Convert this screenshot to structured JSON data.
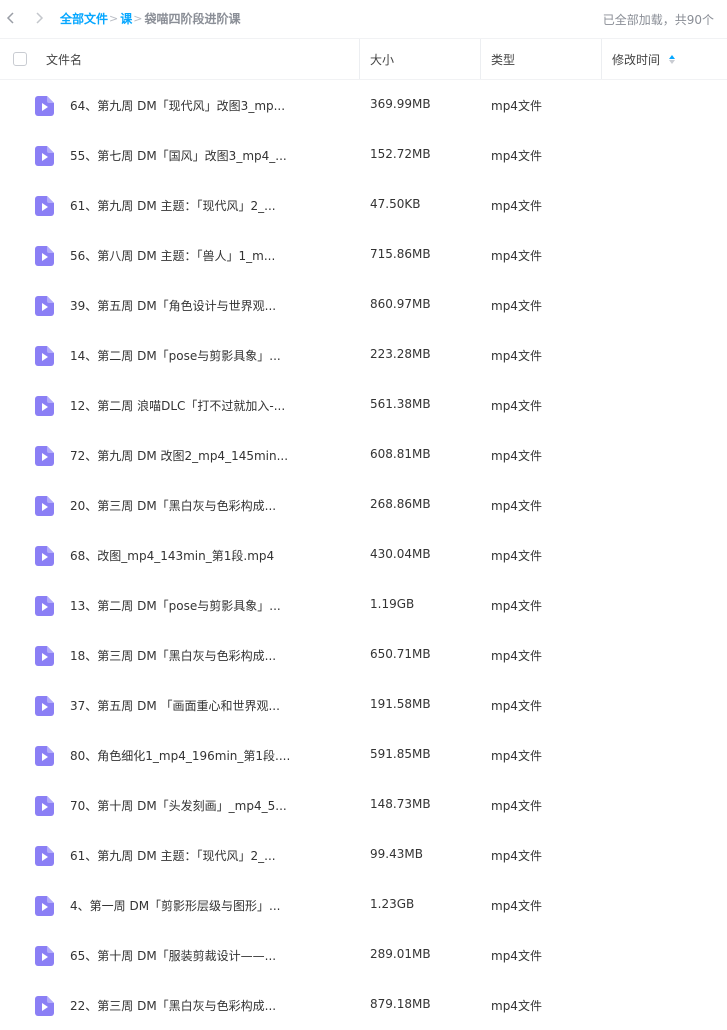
{
  "nav": {
    "breadcrumb": [
      "全部文件",
      "课",
      "袋喵四阶段进阶课"
    ],
    "load_status": "已全部加载，共90个"
  },
  "table": {
    "columns": [
      "文件名",
      "大小",
      "类型",
      "修改时间"
    ],
    "sort_column": "修改时间",
    "rows": [
      {
        "name": "64、第九周 DM「现代风」改图3_mp...",
        "size": "369.99MB",
        "type": "mp4文件"
      },
      {
        "name": "55、第七周 DM「国风」改图3_mp4_...",
        "size": "152.72MB",
        "type": "mp4文件"
      },
      {
        "name": "61、第九周 DM 主题：「现代风」2_...",
        "size": "47.50KB",
        "type": "mp4文件"
      },
      {
        "name": "56、第八周 DM 主题：「兽人」1_m...",
        "size": "715.86MB",
        "type": "mp4文件"
      },
      {
        "name": "39、第五周 DM「角色设计与世界观...",
        "size": "860.97MB",
        "type": "mp4文件"
      },
      {
        "name": "14、第二周 DM「pose与剪影具象」...",
        "size": "223.28MB",
        "type": "mp4文件"
      },
      {
        "name": "12、第二周 浪喵DLC「打不过就加入-...",
        "size": "561.38MB",
        "type": "mp4文件"
      },
      {
        "name": "72、第九周 DM 改图2_mp4_145min...",
        "size": "608.81MB",
        "type": "mp4文件"
      },
      {
        "name": "20、第三周 DM「黑白灰与色彩构成...",
        "size": "268.86MB",
        "type": "mp4文件"
      },
      {
        "name": "68、改图_mp4_143min_第1段.mp4",
        "size": "430.04MB",
        "type": "mp4文件"
      },
      {
        "name": "13、第二周 DM「pose与剪影具象」...",
        "size": "1.19GB",
        "type": "mp4文件"
      },
      {
        "name": "18、第三周 DM「黑白灰与色彩构成...",
        "size": "650.71MB",
        "type": "mp4文件"
      },
      {
        "name": "37、第五周 DM 「画面重心和世界观...",
        "size": "191.58MB",
        "type": "mp4文件"
      },
      {
        "name": "80、角色细化1_mp4_196min_第1段....",
        "size": "591.85MB",
        "type": "mp4文件"
      },
      {
        "name": "70、第十周 DM「头发刻画」_mp4_5...",
        "size": "148.73MB",
        "type": "mp4文件"
      },
      {
        "name": "61、第九周 DM 主题：「现代风」2_...",
        "size": "99.43MB",
        "type": "mp4文件"
      },
      {
        "name": "4、第一周 DM「剪影形层级与图形」...",
        "size": "1.23GB",
        "type": "mp4文件"
      },
      {
        "name": "65、第十周 DM「服装剪裁设计——...",
        "size": "289.01MB",
        "type": "mp4文件"
      },
      {
        "name": "22、第三周 DM「黑白灰与色彩构成...",
        "size": "879.18MB",
        "type": "mp4文件"
      }
    ]
  },
  "icons": {
    "back": "chevron-left-icon",
    "forward": "chevron-right-icon",
    "file": "video-file-icon",
    "sort": "sort-arrows-icon"
  },
  "colors": {
    "accent": "#06a7ff",
    "file_icon": "#8b7ff5",
    "muted_text": "#8a8e96"
  }
}
